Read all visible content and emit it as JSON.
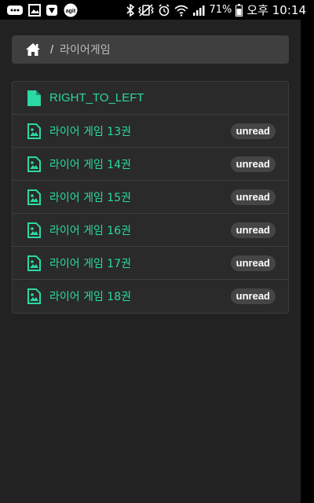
{
  "status_bar": {
    "battery": "71%",
    "time": "오후 10:14",
    "left_icons": [
      "messages-icon",
      "gallery-icon",
      "shopping-icon",
      "agit-icon"
    ],
    "agit_text": "agit",
    "right_icons": [
      "bluetooth-icon",
      "vibrate-icon",
      "alarm-icon",
      "wifi-icon",
      "signal-icon",
      "battery-icon"
    ]
  },
  "breadcrumb": {
    "home_icon": "home-icon",
    "separator": "/",
    "current": "라이어게임"
  },
  "list": {
    "items": [
      {
        "label": "RIGHT_TO_LEFT",
        "icon": "file-icon",
        "badge": null
      },
      {
        "label": "라이어 게임 13권",
        "icon": "image-file-icon",
        "badge": "unread"
      },
      {
        "label": "라이어 게임 14권",
        "icon": "image-file-icon",
        "badge": "unread"
      },
      {
        "label": "라이어 게임 15권",
        "icon": "image-file-icon",
        "badge": "unread"
      },
      {
        "label": "라이어 게임 16권",
        "icon": "image-file-icon",
        "badge": "unread"
      },
      {
        "label": "라이어 게임 17권",
        "icon": "image-file-icon",
        "badge": "unread"
      },
      {
        "label": "라이어 게임 18권",
        "icon": "image-file-icon",
        "badge": "unread"
      }
    ]
  },
  "colors": {
    "accent": "#2ad9a3",
    "background": "#222222",
    "panel": "#2a2a2a",
    "breadcrumb_bg": "#3f3f3f",
    "badge_bg": "#454545"
  }
}
